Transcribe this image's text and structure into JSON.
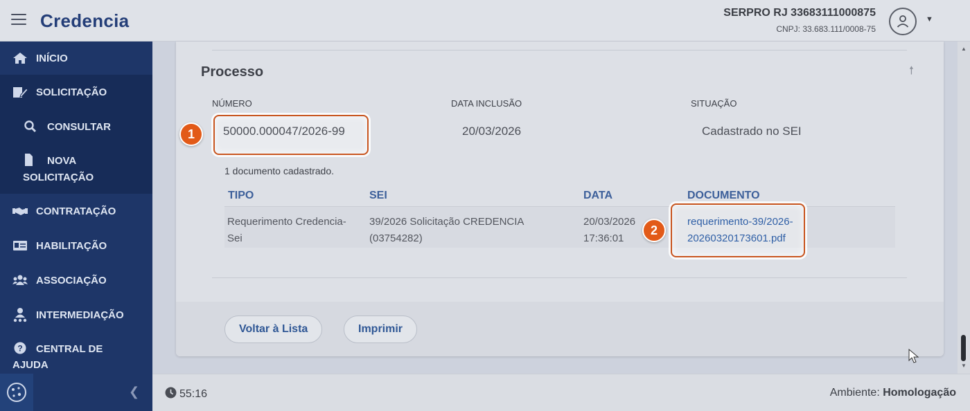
{
  "header": {
    "logo": "Credencia",
    "org_name": "SERPRO RJ 33683111000875",
    "org_cnpj": "CNPJ: 33.683.111/0008-75"
  },
  "sidebar": {
    "items": [
      {
        "label": "INÍCIO",
        "icon": "home-icon"
      },
      {
        "label": "SOLICITAÇÃO",
        "icon": "edit-document-icon"
      },
      {
        "label": "CONSULTAR",
        "icon": "search-icon"
      },
      {
        "label_line1": "NOVA",
        "label_line2": "SOLICITAÇÃO",
        "icon": "file-icon"
      },
      {
        "label": "CONTRATAÇÃO",
        "icon": "handshake-icon"
      },
      {
        "label": "HABILITAÇÃO",
        "icon": "id-card-icon"
      },
      {
        "label": "ASSOCIAÇÃO",
        "icon": "users-icon"
      },
      {
        "label": "INTERMEDIAÇÃO",
        "icon": "person-network-icon"
      },
      {
        "label_line1": "CENTRAL DE",
        "label_line2": "AJUDA",
        "icon": "question-circle-icon"
      }
    ],
    "collapse_icon": "chevron-left-icon",
    "cookie_icon": "cookie-icon"
  },
  "processo": {
    "title": "Processo",
    "headers": {
      "numero": "NÚMERO",
      "data_inclusao": "DATA INCLUSÃO",
      "situacao": "SITUAÇÃO"
    },
    "numero": "50000.000047/2026-99",
    "data_inclusao": "20/03/2026",
    "situacao": "Cadastrado no SEI",
    "doc_count": "1 documento cadastrado."
  },
  "documents_table": {
    "headers": [
      "TIPO",
      "SEI",
      "DATA",
      "DOCUMENTO"
    ],
    "rows": [
      {
        "tipo_l1": "Requerimento Credencia-",
        "tipo_l2": "Sei",
        "sei_l1": "39/2026 Solicitação CREDENCIA",
        "sei_l2": "(03754282)",
        "data_l1": "20/03/2026",
        "data_l2": "17:36:01",
        "doc_l1": "requerimento-39/2026-",
        "doc_l2": "20260320173601.pdf"
      }
    ]
  },
  "actions": {
    "back": "Voltar à Lista",
    "print": "Imprimir"
  },
  "annotations": {
    "badge1": "1",
    "badge2": "2"
  },
  "footer": {
    "timer": "55:16",
    "env_label": "Ambiente: ",
    "env_value": "Homologação"
  },
  "colors": {
    "sidebar": "#1e3668",
    "brand": "#243e78",
    "link": "#2f5fa6",
    "highlight": "#c8541e"
  }
}
